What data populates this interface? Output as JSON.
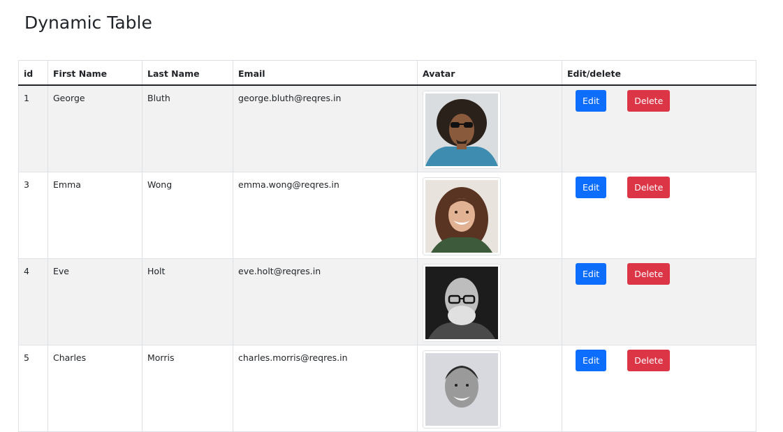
{
  "page": {
    "title": "Dynamic Table"
  },
  "table": {
    "columns": [
      "id",
      "First Name",
      "Last Name",
      "Email",
      "Avatar",
      "Edit/delete"
    ],
    "rows": [
      {
        "id": "1",
        "first_name": "George",
        "last_name": "Bluth",
        "email": "george.bluth@reqres.in",
        "avatar": "avatar-photo"
      },
      {
        "id": "3",
        "first_name": "Emma",
        "last_name": "Wong",
        "email": "emma.wong@reqres.in",
        "avatar": "avatar-photo"
      },
      {
        "id": "4",
        "first_name": "Eve",
        "last_name": "Holt",
        "email": "eve.holt@reqres.in",
        "avatar": "avatar-photo"
      },
      {
        "id": "5",
        "first_name": "Charles",
        "last_name": "Morris",
        "email": "charles.morris@reqres.in",
        "avatar": "avatar-photo"
      }
    ],
    "edit_label": "Edit",
    "delete_label": "Delete"
  },
  "colors": {
    "edit": "#0d6efd",
    "delete": "#dc3545",
    "stripe": "#f2f2f2"
  }
}
